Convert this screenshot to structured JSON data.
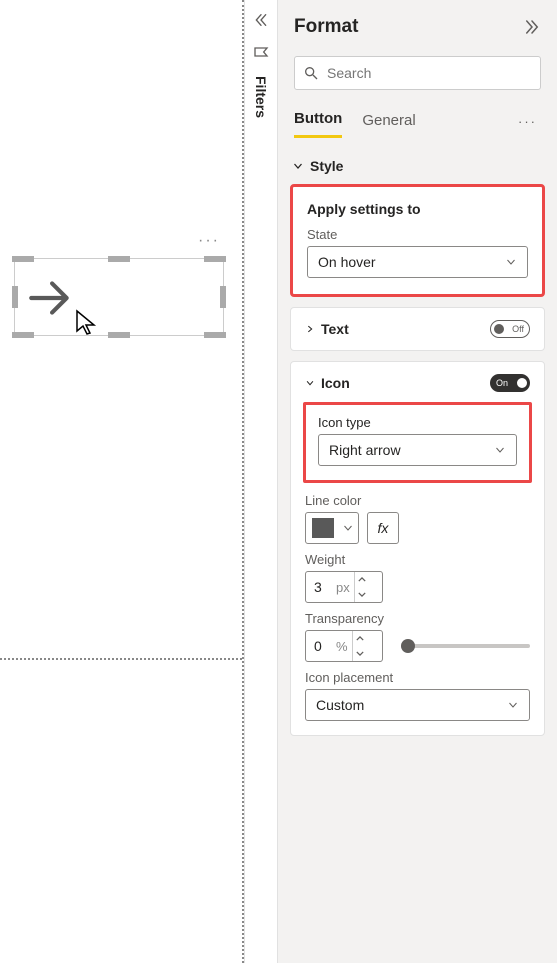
{
  "filters_label": "Filters",
  "pane_title": "Format",
  "search_placeholder": "Search",
  "tabs": {
    "button": "Button",
    "general": "General"
  },
  "sections": {
    "style": "Style",
    "apply_title": "Apply settings to",
    "state_label": "State",
    "state_value": "On hover",
    "text": {
      "title": "Text",
      "toggle": "Off"
    },
    "icon": {
      "title": "Icon",
      "toggle": "On",
      "icon_type_label": "Icon type",
      "icon_type_value": "Right arrow",
      "line_color_label": "Line color",
      "line_color_value": "#595959",
      "fx_label": "fx",
      "weight_label": "Weight",
      "weight_value": "3",
      "weight_unit": "px",
      "transparency_label": "Transparency",
      "transparency_value": "0",
      "transparency_unit": "%",
      "placement_label": "Icon placement",
      "placement_value": "Custom"
    }
  }
}
